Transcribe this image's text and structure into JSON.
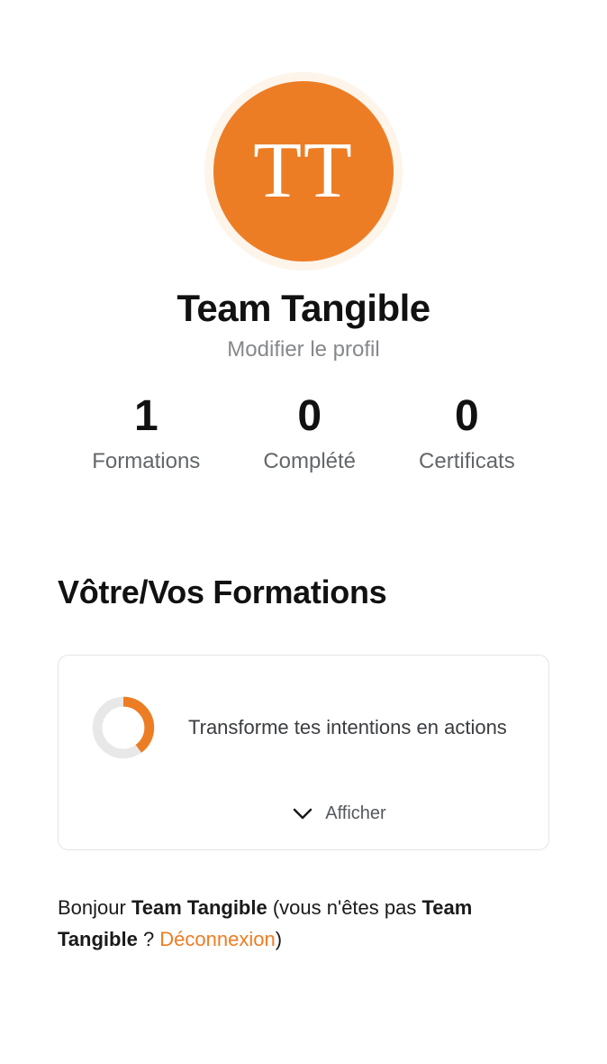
{
  "profile": {
    "avatar_initials": "TT",
    "name": "Team Tangible",
    "edit_label": "Modifier le profil"
  },
  "stats": {
    "formations": {
      "value": "1",
      "label": "Formations"
    },
    "completed": {
      "value": "0",
      "label": "Complété"
    },
    "certificates": {
      "value": "0",
      "label": "Certificats"
    }
  },
  "formations": {
    "section_title": "Vôtre/Vos Formations",
    "card": {
      "title": "Transforme tes intentions en actions",
      "expand_label": "Afficher",
      "progress_percent": 40
    }
  },
  "greeting": {
    "prefix": "Bonjour ",
    "name": "Team Tangible",
    "mid": " (vous n'êtes pas ",
    "name2": "Team Tangible",
    "q": " ? ",
    "logout": "Déconnexion",
    "suffix": ")"
  },
  "colors": {
    "accent": "#ed7d24"
  }
}
